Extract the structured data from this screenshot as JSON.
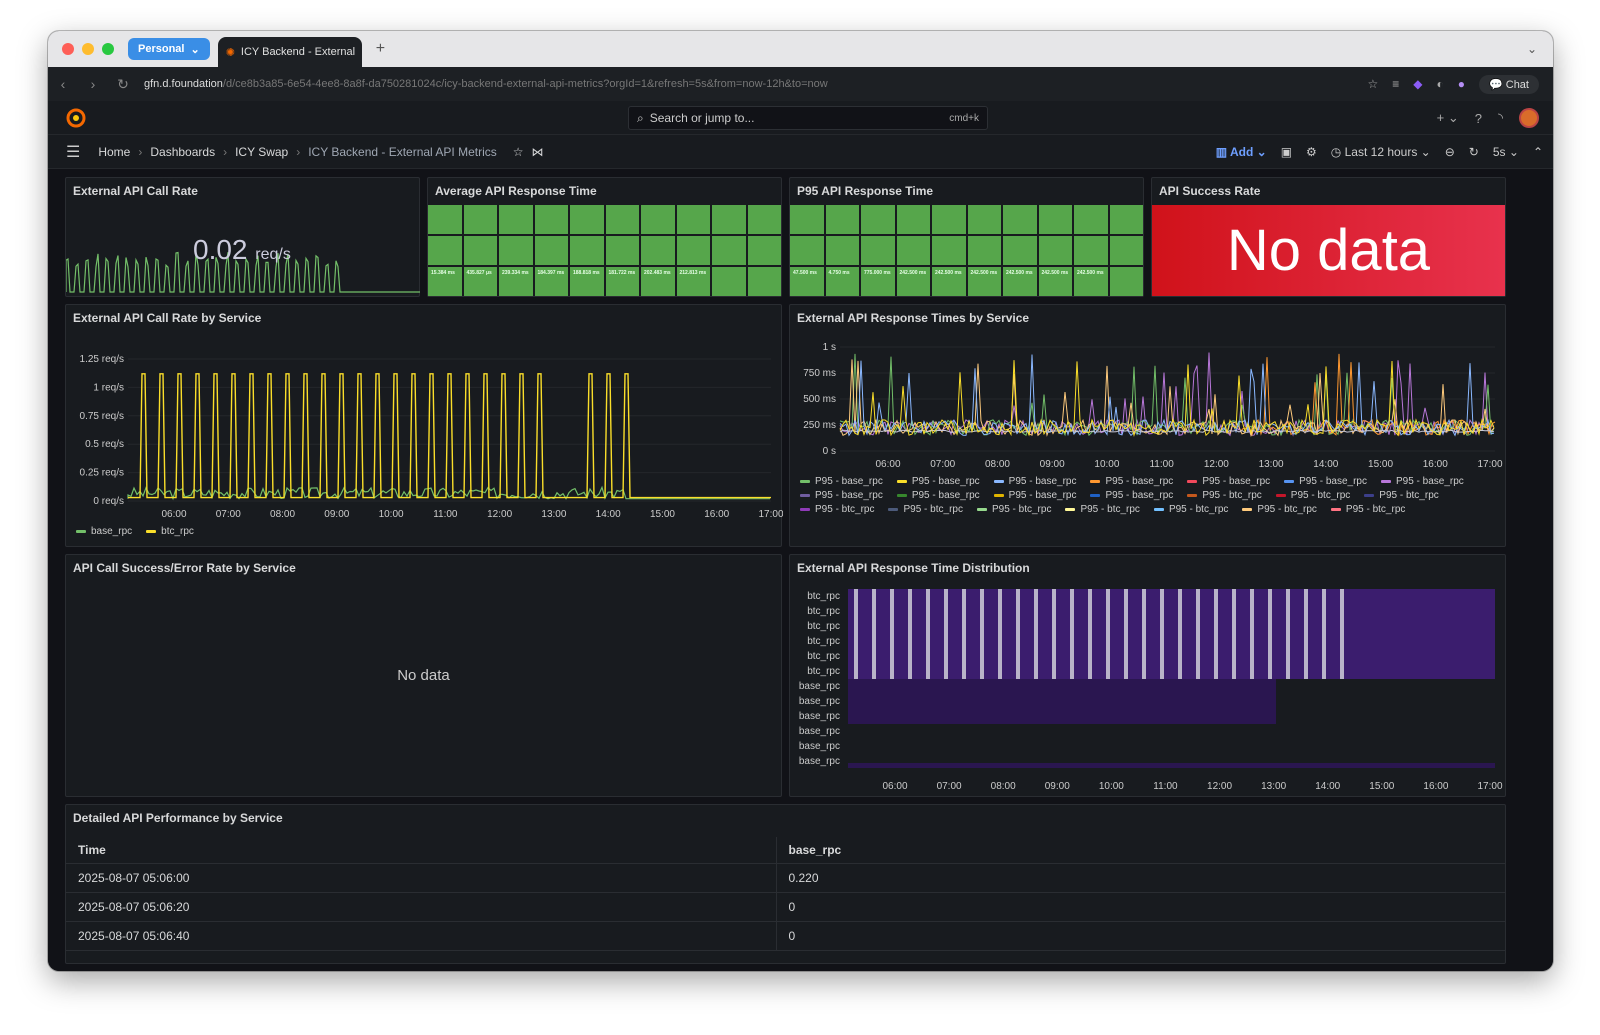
{
  "browser": {
    "profile": "Personal",
    "tab_title": "ICY Backend - External",
    "url_host": "gfn.d.foundation",
    "url_rest": "/d/ce8b3a85-6e54-4ee8-8a8f-da750281024c/icy-backend-external-api-metrics?orgId=1&refresh=5s&from=now-12h&to=now",
    "chat_label": "Chat"
  },
  "grafana": {
    "search_placeholder": "Search or jump to...",
    "search_shortcut": "cmd+k"
  },
  "breadcrumb": {
    "home": "Home",
    "dashboards": "Dashboards",
    "folder": "ICY Swap",
    "current": "ICY Backend - External API Metrics"
  },
  "toolbar": {
    "add_label": "Add",
    "time_range": "Last 12 hours",
    "refresh_interval": "5s"
  },
  "panels": {
    "call_rate": {
      "title": "External API Call Rate",
      "value": "0.02",
      "unit": "req/s"
    },
    "avg_response": {
      "title": "Average API Response Time"
    },
    "p95_response": {
      "title": "P95 API Response Time"
    },
    "success_rate": {
      "title": "API Success Rate",
      "no_data": "No data"
    },
    "rate_by_service": {
      "title": "External API Call Rate by Service"
    },
    "response_times_by_service": {
      "title": "External API Response Times by Service"
    },
    "success_error": {
      "title": "API Call Success/Error Rate by Service",
      "no_data": "No data"
    },
    "distribution": {
      "title": "External API Response Time Distribution"
    },
    "detailed": {
      "title": "Detailed API Performance by Service"
    }
  },
  "avg_stat_values": [
    "15.384 ms",
    "435.827 μs",
    "239.334 ms",
    "184.397 ms",
    "188.818 ms",
    "181.722 ms",
    "202.483 ms",
    "212.813 ms",
    "",
    ""
  ],
  "p95_stat_values": [
    "47.500 ms",
    "4.750 ms",
    "775.000 ms",
    "242.500 ms",
    "242.500 ms",
    "242.500 ms",
    "242.500 ms",
    "242.500 ms",
    "242.500 ms",
    ""
  ],
  "chart_data": [
    {
      "type": "line",
      "name": "rate_by_service",
      "x": [
        "06:00",
        "07:00",
        "08:00",
        "09:00",
        "10:00",
        "11:00",
        "12:00",
        "13:00",
        "14:00",
        "15:00",
        "16:00",
        "17:00"
      ],
      "ylim": [
        0,
        1.25
      ],
      "yticks": [
        "0 req/s",
        "0.25 req/s",
        "0.5 req/s",
        "0.75 req/s",
        "1 req/s",
        "1.25 req/s"
      ],
      "series": [
        {
          "name": "base_rpc",
          "color": "#73bf69"
        },
        {
          "name": "btc_rpc",
          "color": "#fade2a"
        }
      ]
    },
    {
      "type": "line",
      "name": "response_times_by_service",
      "x": [
        "06:00",
        "07:00",
        "08:00",
        "09:00",
        "10:00",
        "11:00",
        "12:00",
        "13:00",
        "14:00",
        "15:00",
        "16:00",
        "17:00"
      ],
      "yticks": [
        "0 s",
        "250 ms",
        "500 ms",
        "750 ms",
        "1 s"
      ],
      "legend": [
        {
          "name": "P95 - base_rpc",
          "color": "#73bf69"
        },
        {
          "name": "P95 - base_rpc",
          "color": "#fade2a"
        },
        {
          "name": "P95 - base_rpc",
          "color": "#8ab8ff"
        },
        {
          "name": "P95 - base_rpc",
          "color": "#ff9830"
        },
        {
          "name": "P95 - base_rpc",
          "color": "#f2495c"
        },
        {
          "name": "P95 - base_rpc",
          "color": "#5794f2"
        },
        {
          "name": "P95 - base_rpc",
          "color": "#b877d9"
        },
        {
          "name": "P95 - base_rpc",
          "color": "#705da0"
        },
        {
          "name": "P95 - base_rpc",
          "color": "#37872d"
        },
        {
          "name": "P95 - base_rpc",
          "color": "#e0b400"
        },
        {
          "name": "P95 - base_rpc",
          "color": "#1f60c4"
        },
        {
          "name": "P95 - btc_rpc",
          "color": "#c4581d"
        },
        {
          "name": "P95 - btc_rpc",
          "color": "#c4162a"
        },
        {
          "name": "P95 - btc_rpc",
          "color": "#3c3f8a"
        },
        {
          "name": "P95 - btc_rpc",
          "color": "#8f3bb8"
        },
        {
          "name": "P95 - btc_rpc",
          "color": "#4c5a7a"
        },
        {
          "name": "P95 - btc_rpc",
          "color": "#96d98d"
        },
        {
          "name": "P95 - btc_rpc",
          "color": "#fff899"
        },
        {
          "name": "P95 - btc_rpc",
          "color": "#73c0ff"
        },
        {
          "name": "P95 - btc_rpc",
          "color": "#ffcb7d"
        },
        {
          "name": "P95 - btc_rpc",
          "color": "#ff7383"
        }
      ]
    },
    {
      "type": "heatmap",
      "name": "distribution",
      "x": [
        "06:00",
        "07:00",
        "08:00",
        "09:00",
        "10:00",
        "11:00",
        "12:00",
        "13:00",
        "14:00",
        "15:00",
        "16:00",
        "17:00"
      ],
      "rows": [
        "btc_rpc",
        "btc_rpc",
        "btc_rpc",
        "btc_rpc",
        "btc_rpc",
        "btc_rpc",
        "base_rpc",
        "base_rpc",
        "base_rpc",
        "base_rpc",
        "base_rpc",
        "base_rpc"
      ]
    },
    {
      "type": "table",
      "name": "detailed",
      "columns": [
        "Time",
        "base_rpc"
      ],
      "rows": [
        [
          "2025-08-07 05:06:00",
          "0.220"
        ],
        [
          "2025-08-07 05:06:20",
          "0"
        ],
        [
          "2025-08-07 05:06:40",
          "0"
        ]
      ]
    }
  ]
}
